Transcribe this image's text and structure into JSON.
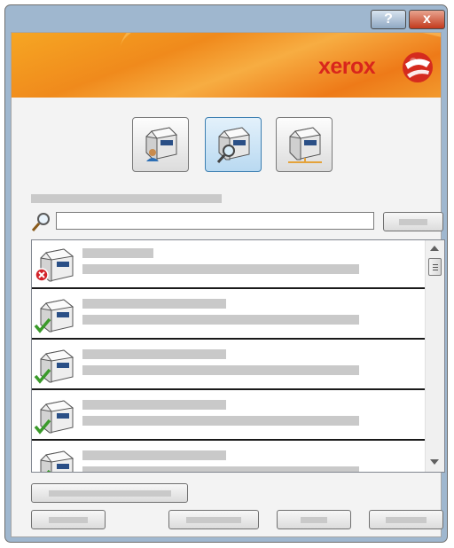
{
  "window": {
    "title": "",
    "help_label": "?",
    "close_label": "x"
  },
  "brand": {
    "logo_text": "xerox",
    "accent": "#f08a1c",
    "logo_color": "#d9261c"
  },
  "mode_buttons": [
    {
      "icon": "printer-user-icon",
      "selected": false
    },
    {
      "icon": "printer-search-icon",
      "selected": true
    },
    {
      "icon": "printer-network-icon",
      "selected": false
    }
  ],
  "search": {
    "label": "",
    "value": "",
    "placeholder": "",
    "button_label": ""
  },
  "printers": [
    {
      "name": "",
      "description": "",
      "status": "error-icon"
    },
    {
      "name": "",
      "description": "",
      "status": "check-icon"
    },
    {
      "name": "",
      "description": "",
      "status": "check-icon"
    },
    {
      "name": "",
      "description": "",
      "status": "check-icon"
    },
    {
      "name": "",
      "description": "",
      "status": "check-icon"
    }
  ],
  "footer": {
    "wide_button_label": "",
    "left_button_label": "",
    "back_button_label": "",
    "next_button_label": "",
    "cancel_button_label": ""
  }
}
